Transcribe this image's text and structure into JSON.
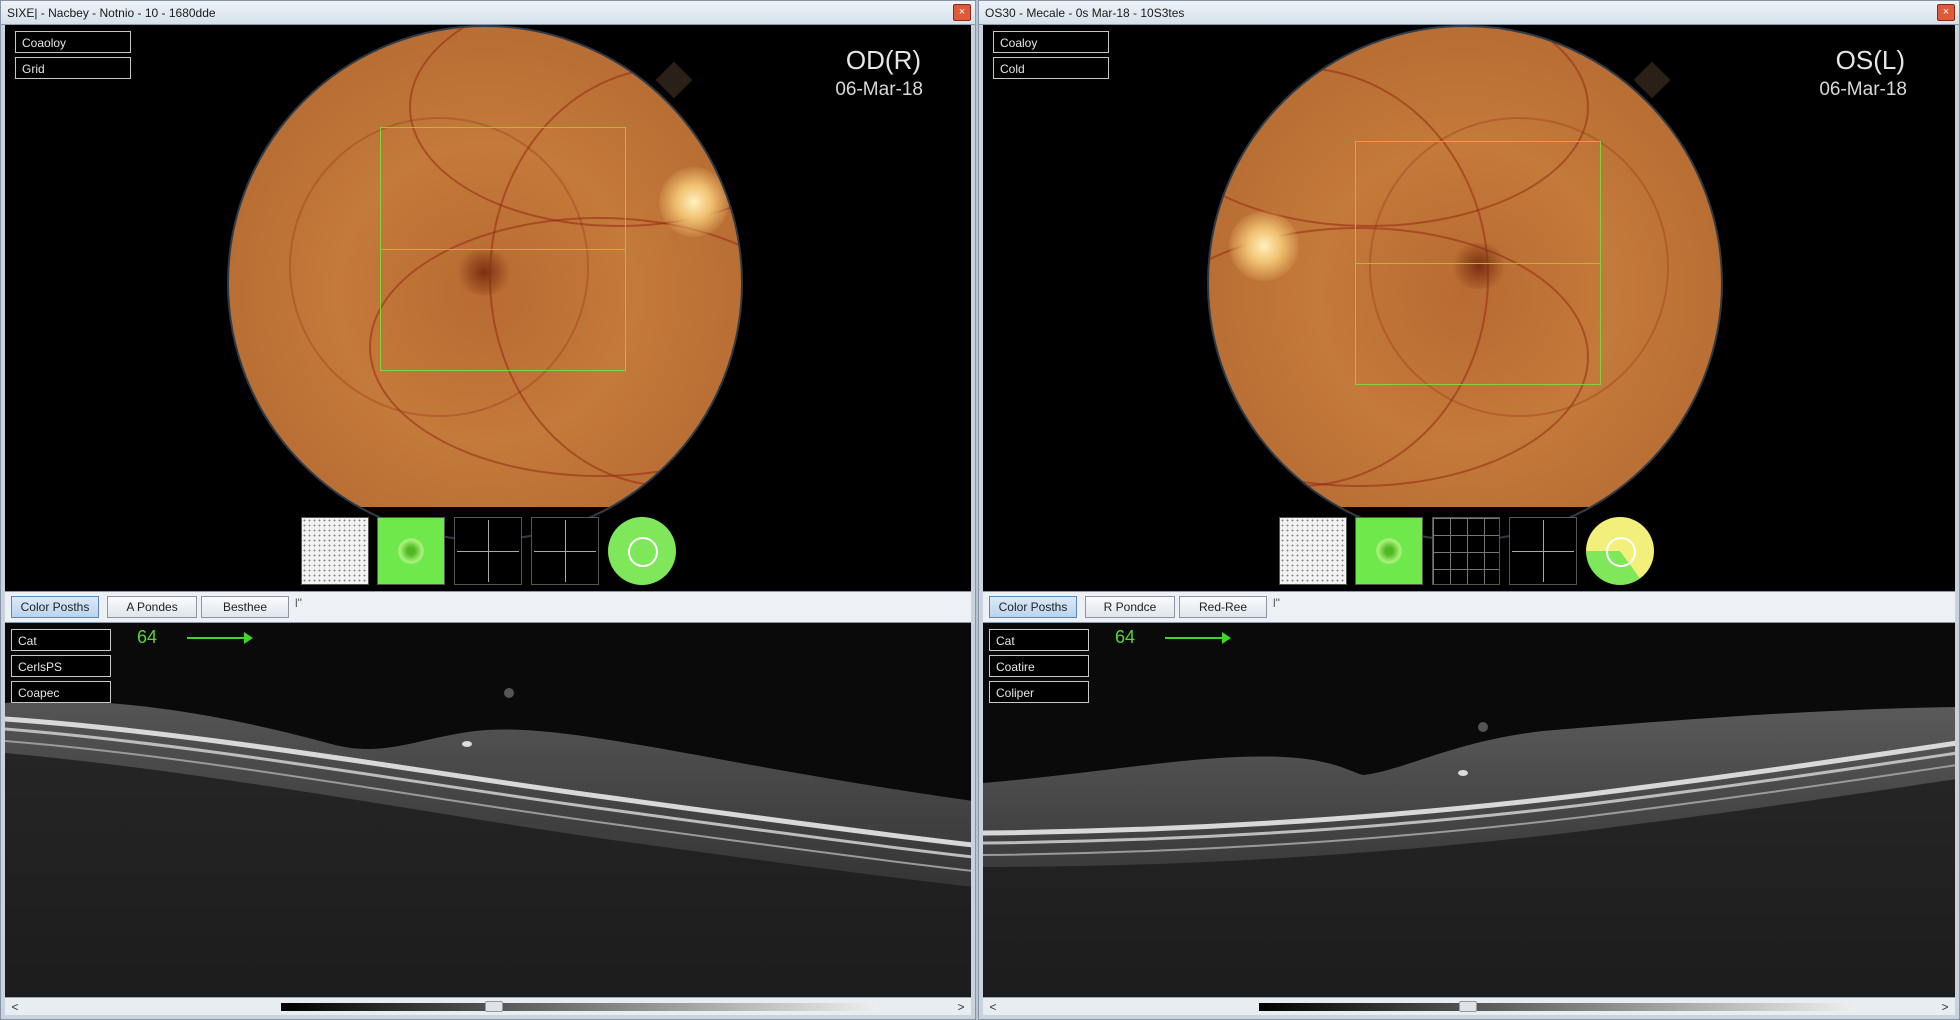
{
  "left": {
    "title": "SIXE| - Nacbey - Notnio - 10 - 1680dde",
    "close": "×",
    "overlay_buttons": [
      "Coaoloy",
      "Grid"
    ],
    "eye": "OD(R)",
    "date": "06-Mar-18",
    "tabs": [
      "Color Posths",
      "A Pondes",
      "Besthee"
    ],
    "tab_more": "l\"",
    "oct_buttons": [
      "Cat",
      "CerlsPS",
      "Coapec"
    ],
    "oct_number": "64",
    "scroll_left": "<",
    "scroll_right": ">"
  },
  "right": {
    "title": "OS30 - Mecale - 0s Mar-18 - 10S3tes",
    "close": "×",
    "overlay_buttons": [
      "Coaloy",
      "Cold"
    ],
    "eye": "OS(L)",
    "date": "06-Mar-18",
    "tabs": [
      "Color Posths",
      "R Pondce",
      "Red-Ree"
    ],
    "tab_more": "l\"",
    "oct_buttons": [
      "Cat",
      "Coatire",
      "Coliper"
    ],
    "oct_number": "64",
    "scroll_left": "<",
    "scroll_right": ">"
  },
  "icons": {
    "close": "close-icon",
    "thumbnails": [
      "dot-pattern-icon",
      "green-map-icon",
      "grid-icon",
      "quadrant-grid-icon",
      "circle-map-icon"
    ]
  },
  "colors": {
    "grid_overlay": "#7fd43a",
    "oct_arrow": "#3fd42a",
    "active_tab": "#b9d4ef"
  }
}
